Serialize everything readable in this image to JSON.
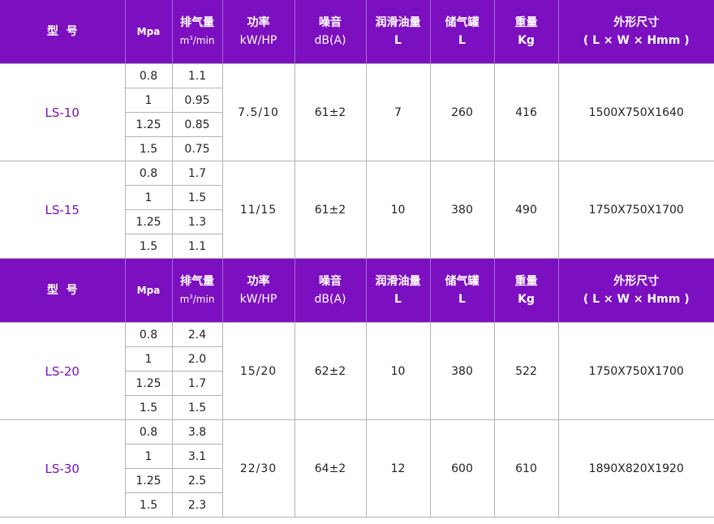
{
  "header": {
    "model": "型  号",
    "mpa": "Mpa",
    "flow_line1": "排气量",
    "flow_line2_pre": "m",
    "flow_line2_sup": "3",
    "flow_line2_post": "/min",
    "power_line1": "功率",
    "power_line2": "kW/HP",
    "noise_line1": "噪音",
    "noise_line2": "dB(A)",
    "oil_line1": "润滑油量",
    "oil_line2": "L",
    "tank_line1": "储气罐",
    "tank_line2": "L",
    "weight_line1": "重量",
    "weight_line2": "Kg",
    "dim_line1": "外形尺寸",
    "dim_line2": "( L × W × Hmm )"
  },
  "models": [
    {
      "name": "LS-10",
      "rows": [
        {
          "mpa": "0.8",
          "flow": "1.1"
        },
        {
          "mpa": "1",
          "flow": "0.95"
        },
        {
          "mpa": "1.25",
          "flow": "0.85"
        },
        {
          "mpa": "1.5",
          "flow": "0.75"
        }
      ],
      "power": "7.5/10",
      "noise": "61±2",
      "oil": "7",
      "tank": "260",
      "weight": "416",
      "dimensions": "1500X750X1640"
    },
    {
      "name": "LS-15",
      "rows": [
        {
          "mpa": "0.8",
          "flow": "1.7"
        },
        {
          "mpa": "1",
          "flow": "1.5"
        },
        {
          "mpa": "1.25",
          "flow": "1.3"
        },
        {
          "mpa": "1.5",
          "flow": "1.1"
        }
      ],
      "power": "11/15",
      "noise": "61±2",
      "oil": "10",
      "tank": "380",
      "weight": "490",
      "dimensions": "1750X750X1700"
    },
    {
      "name": "LS-20",
      "rows": [
        {
          "mpa": "0.8",
          "flow": "2.4"
        },
        {
          "mpa": "1",
          "flow": "2.0"
        },
        {
          "mpa": "1.25",
          "flow": "1.7"
        },
        {
          "mpa": "1.5",
          "flow": "1.5"
        }
      ],
      "power": "15/20",
      "noise": "62±2",
      "oil": "10",
      "tank": "380",
      "weight": "522",
      "dimensions": "1750X750X1700"
    },
    {
      "name": "LS-30",
      "rows": [
        {
          "mpa": "0.8",
          "flow": "3.8"
        },
        {
          "mpa": "1",
          "flow": "3.1"
        },
        {
          "mpa": "1.25",
          "flow": "2.5"
        },
        {
          "mpa": "1.5",
          "flow": "2.3"
        }
      ],
      "power": "22/30",
      "noise": "64±2",
      "oil": "12",
      "tank": "600",
      "weight": "610",
      "dimensions": "1890X820X1920"
    }
  ],
  "colors": {
    "header_bg": "#7c0fc0",
    "model_text": "#7c0fc0",
    "border": "#b4b4b4"
  }
}
